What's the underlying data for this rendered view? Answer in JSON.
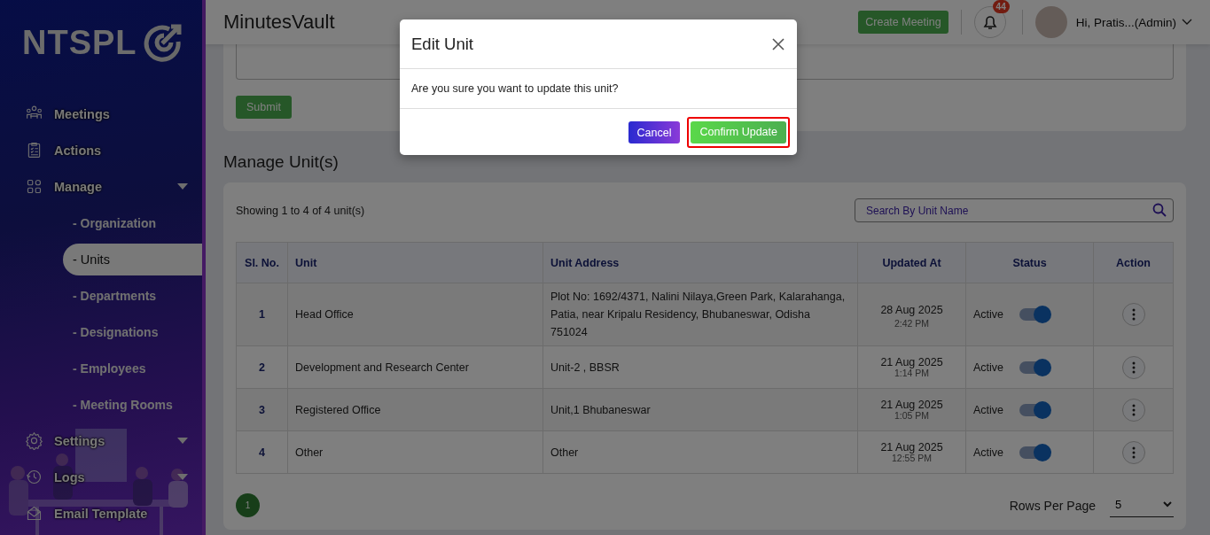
{
  "sidebar": {
    "logo": "NTSPL",
    "items": [
      {
        "label": "Meetings",
        "caret": false
      },
      {
        "label": "Actions",
        "caret": false
      },
      {
        "label": "Manage",
        "caret": true,
        "children": [
          {
            "label": "- Organization",
            "selected": false
          },
          {
            "label": "- Units",
            "selected": true
          },
          {
            "label": "- Departments",
            "selected": false
          },
          {
            "label": "- Designations",
            "selected": false
          },
          {
            "label": "- Employees",
            "selected": false
          },
          {
            "label": "- Meeting Rooms",
            "selected": false
          }
        ]
      },
      {
        "label": "Settings",
        "caret": true
      },
      {
        "label": "Logs",
        "caret": true
      },
      {
        "label": "Email Template",
        "caret": false
      }
    ]
  },
  "header": {
    "title": "MinutesVault",
    "create_button": "Create Meeting",
    "notification_count": "44",
    "user": "Hi, Pratis...(Admin)"
  },
  "form": {
    "submit_button": "Submit"
  },
  "section_title": "Manage Unit(s)",
  "table_card": {
    "summary": "Showing 1 to 4 of 4 unit(s)",
    "search": {
      "placeholder": "Search By Unit Name"
    },
    "columns": [
      "Sl. No.",
      "Unit",
      "Unit Address",
      "Updated At",
      "Status",
      "Action"
    ],
    "rows": [
      {
        "sl": "1",
        "unit": "Head Office",
        "address": "Plot No: 1692/4371, Nalini Nilaya,Green Park, Kalarahanga, Patia, near Kripalu Residency, Bhubaneswar, Odisha 751024",
        "date": "28 Aug 2025",
        "time": "2:42 PM",
        "status": "Active",
        "on": true
      },
      {
        "sl": "2",
        "unit": "Development and Research Center",
        "address": "Unit-2 , BBSR",
        "date": "21 Aug 2025",
        "time": "1:14 PM",
        "status": "Active",
        "on": true
      },
      {
        "sl": "3",
        "unit": "Registered Office",
        "address": "Unit,1 Bhubaneswar",
        "date": "21 Aug 2025",
        "time": "1:05 PM",
        "status": "Active",
        "on": true
      },
      {
        "sl": "4",
        "unit": "Other",
        "address": "Other",
        "date": "21 Aug 2025",
        "time": "12:55 PM",
        "status": "Active",
        "on": true
      }
    ],
    "pages": [
      {
        "label": "1",
        "selected": true
      }
    ],
    "rows_per_page": {
      "label": "Rows Per Page",
      "value": "5"
    }
  },
  "dialog": {
    "title": "Edit Unit",
    "message": "Are you sure you want to update this unit?",
    "buttons": [
      {
        "label": "Cancel",
        "kind": "secondary",
        "highlighted": false
      },
      {
        "label": "Confirm Update",
        "kind": "primary",
        "highlighted": true
      }
    ]
  }
}
